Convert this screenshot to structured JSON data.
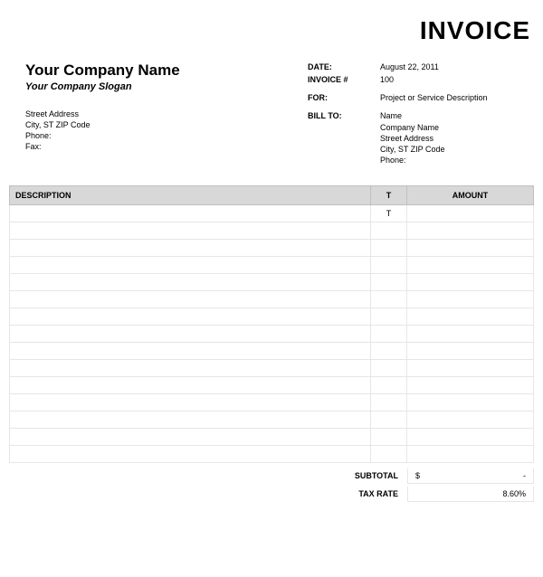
{
  "title": "INVOICE",
  "company": {
    "name": "Your Company Name",
    "slogan": "Your Company Slogan",
    "street": "Street Address",
    "city_line": "City, ST  ZIP Code",
    "phone_label": "Phone:",
    "fax_label": "Fax:"
  },
  "meta": {
    "date_label": "DATE:",
    "date_value": "August 22, 2011",
    "invoice_num_label": "INVOICE #",
    "invoice_num_value": "100",
    "for_label": "FOR:",
    "for_value": "Project or Service Description",
    "billto_label": "BILL TO:",
    "billto": {
      "name": "Name",
      "company": "Company Name",
      "street": "Street Address",
      "city_line": "City, ST  ZIP Code",
      "phone_label": "Phone:"
    }
  },
  "table_headers": {
    "description": "DESCRIPTION",
    "t": "T",
    "amount": "AMOUNT"
  },
  "first_row_t": "T",
  "totals": {
    "subtotal_label": "SUBTOTAL",
    "subtotal_currency": "$",
    "subtotal_value": "-",
    "tax_rate_label": "TAX RATE",
    "tax_rate_value": "8.60%"
  }
}
